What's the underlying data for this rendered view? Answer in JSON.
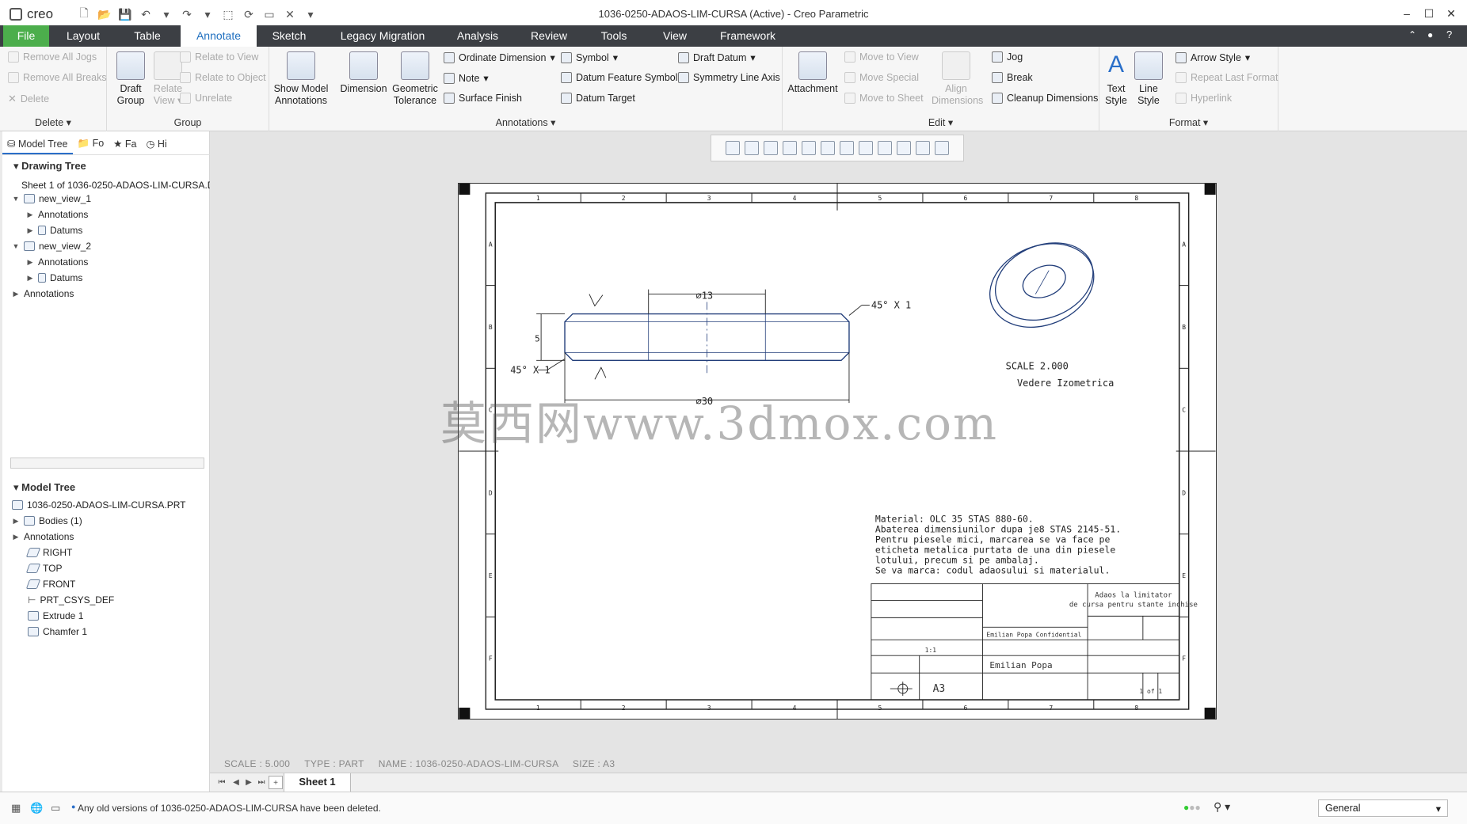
{
  "app": {
    "logo": "creo",
    "window_title": "1036-0250-ADAOS-LIM-CURSA (Active) - Creo Parametric"
  },
  "tabs": [
    "File",
    "Layout",
    "Table",
    "Annotate",
    "Sketch",
    "Legacy Migration",
    "Analysis",
    "Review",
    "Tools",
    "View",
    "Framework"
  ],
  "active_tab": "Annotate",
  "ribbon": {
    "delete_group": {
      "label": "Delete",
      "remove_all_jogs": "Remove All Jogs",
      "remove_all_breaks": "Remove All Breaks",
      "delete": "Delete"
    },
    "group_group": {
      "label": "Group",
      "draft_group": "Draft Group",
      "relate_view": "Relate View",
      "relate_to_view": "Relate to View",
      "relate_to_object": "Relate to Object",
      "unrelate": "Unrelate"
    },
    "annotations_group": {
      "label": "Annotations",
      "show_model_annotations": "Show Model Annotations",
      "dimension": "Dimension",
      "geometric_tolerance": "Geometric Tolerance",
      "ordinate_dimension": "Ordinate Dimension",
      "note": "Note",
      "surface_finish": "Surface Finish",
      "symbol": "Symbol",
      "datum_feature_symbol": "Datum Feature Symbol",
      "datum_target": "Datum Target",
      "draft_datum": "Draft Datum",
      "symmetry_line_axis": "Symmetry Line Axis"
    },
    "edit_group": {
      "label": "Edit",
      "attachment": "Attachment",
      "move_to_view": "Move to View",
      "move_special": "Move Special",
      "move_to_sheet": "Move to Sheet",
      "align_dimensions": "Align Dimensions",
      "jog": "Jog",
      "break": "Break",
      "cleanup_dimensions": "Cleanup Dimensions"
    },
    "format_group": {
      "label": "Format",
      "text_style": "Text Style",
      "line_style": "Line Style",
      "arrow_style": "Arrow Style",
      "repeat_last_format": "Repeat Last Format",
      "hyperlink": "Hyperlink"
    }
  },
  "panel_tabs": [
    "Model Tree",
    "Fo",
    "Fa",
    "Hi"
  ],
  "drawing_tree": {
    "header": "Drawing Tree",
    "items": [
      {
        "label": "Sheet 1 of 1036-0250-ADAOS-LIM-CURSA.D",
        "level": 0
      },
      {
        "label": "new_view_1",
        "level": 0
      },
      {
        "label": "Annotations",
        "level": 1
      },
      {
        "label": "Datums",
        "level": 1
      },
      {
        "label": "new_view_2",
        "level": 0
      },
      {
        "label": "Annotations",
        "level": 1
      },
      {
        "label": "Datums",
        "level": 1
      },
      {
        "label": "Annotations",
        "level": 0
      }
    ]
  },
  "model_tree": {
    "header": "Model Tree",
    "items": [
      {
        "label": "1036-0250-ADAOS-LIM-CURSA.PRT",
        "level": 0
      },
      {
        "label": "Bodies (1)",
        "level": 0
      },
      {
        "label": "Annotations",
        "level": 0
      },
      {
        "label": "RIGHT",
        "level": 1
      },
      {
        "label": "TOP",
        "level": 1
      },
      {
        "label": "FRONT",
        "level": 1
      },
      {
        "label": "PRT_CSYS_DEF",
        "level": 1
      },
      {
        "label": "Extrude 1",
        "level": 1
      },
      {
        "label": "Chamfer 1",
        "level": 1
      }
    ]
  },
  "drawing": {
    "dims": {
      "d13": "⌀13",
      "d30": "⌀30",
      "h5": "5",
      "chamfer_top": "45° X 1",
      "chamfer_left": "45° X 1"
    },
    "iso_scale": "SCALE 2.000",
    "iso_caption": "Vedere Izometrica",
    "notes": [
      "Material: OLC 35 STAS 880-60.",
      "Abaterea dimensiunilor dupa je8 STAS 2145-51.",
      "Pentru piesele mici, marcarea se va face pe",
      "eticheta metalica purtata de una din piesele",
      "lotului, precum si pe ambalaj.",
      "Se va marca: codul adaosului si materialul."
    ],
    "zone_cols": [
      "1",
      "2",
      "3",
      "4",
      "5",
      "6",
      "7",
      "8"
    ],
    "zone_rows": [
      "A",
      "B",
      "C",
      "D",
      "E",
      "F"
    ],
    "title_block": {
      "description_value": "Adaos la limitator de cursa pentru stante inchise",
      "company": "Emilian Popa Confidential",
      "author": "Emilian Popa",
      "size": "A3",
      "sheet": "1 of 1",
      "scale": "1:1"
    }
  },
  "watermark": "莫西网www.3dmox.com",
  "status_info": "SCALE : 5.000     TYPE : PART     NAME : 1036-0250-ADAOS-LIM-CURSA     SIZE : A3",
  "sheet_tab": "Sheet 1",
  "message": "Any old versions of 1036-0250-ADAOS-LIM-CURSA have been deleted.",
  "filter_select": "General"
}
